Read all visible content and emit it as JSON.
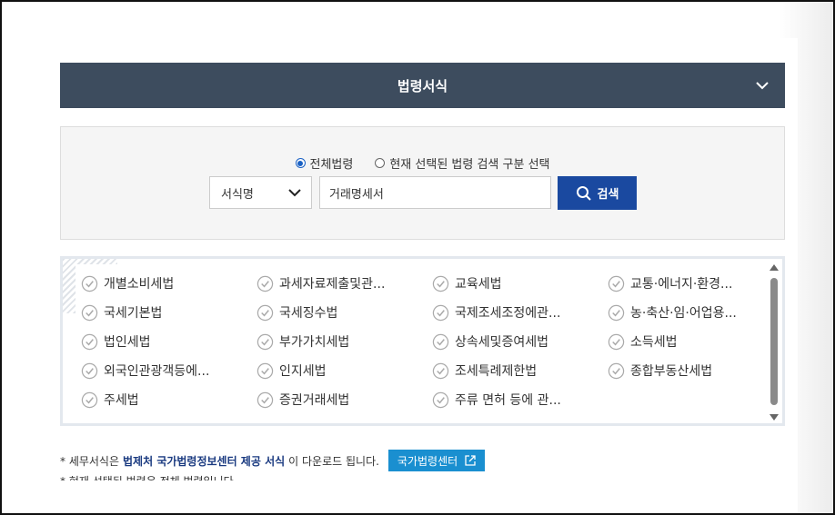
{
  "header": {
    "title": "법령서식"
  },
  "search": {
    "radio_all": "전체법령",
    "radio_selected": "현재 선택된 법령 검색 구분 선택",
    "select_value": "서식명",
    "input_value": "거래명세서",
    "button_label": "검색"
  },
  "laws": [
    "개별소비세법",
    "과세자료제출및관...",
    "교육세법",
    "교통·에너지·환경...",
    "국세기본법",
    "국세징수법",
    "국제조세조정에관...",
    "농·축산·임·어업용...",
    "법인세법",
    "부가가치세법",
    "상속세및증여세법",
    "소득세법",
    "외국인관광객등에...",
    "인지세법",
    "조세특례제한법",
    "종합부동산세법",
    "주세법",
    "증권거래세법",
    "주류 면허 등에 관..."
  ],
  "notice": {
    "prefix": "* 세무서식은",
    "highlight": "법제처 국가법령정보센터 제공 서식",
    "suffix": "이 다운로드 됩니다.",
    "button_label": "국가법령센터",
    "line2": "* 현재 선택된 법령은 전체 법령입니다."
  }
}
